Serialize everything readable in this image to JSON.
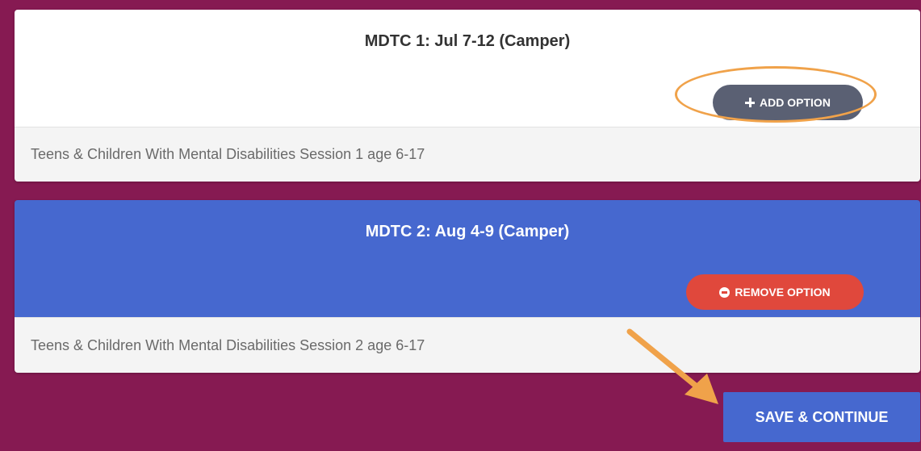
{
  "options": [
    {
      "title": "MDTC 1: Jul 7-12 (Camper)",
      "button_label": "ADD OPTION",
      "button_icon": "plus-icon",
      "description": "Teens & Children With Mental Disabilities Session 1 age 6-17"
    },
    {
      "title": "MDTC 2: Aug 4-9 (Camper)",
      "button_label": "REMOVE OPTION",
      "button_icon": "minus-circle-icon",
      "description": "Teens & Children With Mental Disabilities Session 2 age 6-17"
    }
  ],
  "footer": {
    "save_label": "SAVE & CONTINUE"
  },
  "colors": {
    "background": "#861a52",
    "selected_card": "#4668cf",
    "add_button": "#5a6073",
    "remove_button": "#e0483c",
    "annotation": "#f0a24a"
  }
}
